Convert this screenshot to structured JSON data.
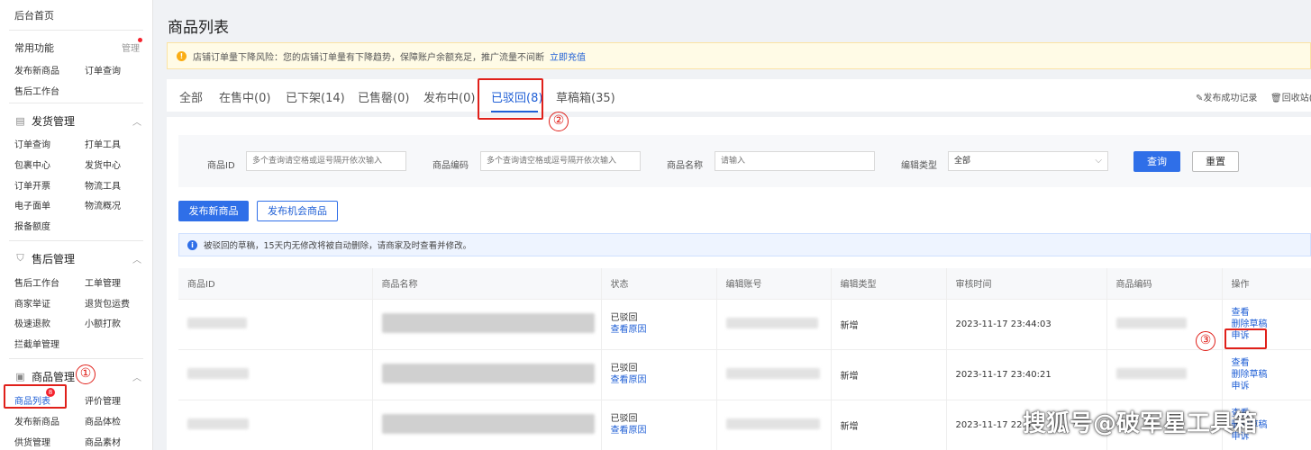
{
  "sidebar": {
    "home": "后台首页",
    "common_title": "常用功能",
    "common_manage": "管理",
    "common_items": [
      "发布新商品",
      "订单查询",
      "售后工作台"
    ],
    "sections": [
      {
        "title": "发货管理",
        "items": [
          "订单查询",
          "打单工具",
          "包裹中心",
          "发货中心",
          "订单开票",
          "物流工具",
          "电子面单",
          "物流概况",
          "报备额度"
        ]
      },
      {
        "title": "售后管理",
        "items": [
          "售后工作台",
          "工单管理",
          "商家举证",
          "退货包运费",
          "极速退款",
          "小额打款",
          "拦截单管理"
        ]
      },
      {
        "title": "商品管理",
        "items": [
          "商品列表",
          "评价管理",
          "发布新商品",
          "商品体检",
          "供货管理",
          "商品素材"
        ]
      }
    ],
    "badge_count": "8"
  },
  "annotations": [
    "①",
    "②",
    "③"
  ],
  "page": {
    "title": "商品列表",
    "warning": "店铺订单量下降风险：您的店铺订单量有下降趋势，保障账户余额充足，推广流量不间断",
    "warning_link": "立即充值"
  },
  "tabs": [
    {
      "label": "全部"
    },
    {
      "label": "在售中(0)"
    },
    {
      "label": "已下架(14)"
    },
    {
      "label": "已售罄(0)"
    },
    {
      "label": "发布中(0)"
    },
    {
      "label": "已驳回(8)"
    },
    {
      "label": "草稿箱(35)"
    }
  ],
  "tab_links": {
    "publish_record": "发布成功记录",
    "recycle": "回收站("
  },
  "filters": {
    "id_label": "商品ID",
    "id_placeholder": "多个查询请空格或逗号隔开依次输入",
    "code_label": "商品编码",
    "code_placeholder": "多个查询请空格或逗号隔开依次输入",
    "name_label": "商品名称",
    "name_placeholder": "请输入",
    "type_label": "编辑类型",
    "type_value": "全部",
    "query": "查询",
    "reset": "重置"
  },
  "actions": {
    "publish_new": "发布新商品",
    "publish_opportunity": "发布机会商品"
  },
  "info": "被驳回的草稿，15天内无修改将被自动删除，请商家及时查看并修改。",
  "table": {
    "headers": [
      "商品ID",
      "商品名称",
      "状态",
      "编辑账号",
      "编辑类型",
      "审核时间",
      "商品编码",
      "操作"
    ],
    "rows": [
      {
        "status": "已驳回",
        "reason": "查看原因",
        "type": "新增",
        "time": "2023-11-17 23:44:03",
        "ops": [
          "查看",
          "删除草稿",
          "申诉"
        ]
      },
      {
        "status": "已驳回",
        "reason": "查看原因",
        "type": "新增",
        "time": "2023-11-17 23:40:21",
        "ops": [
          "查看",
          "删除草稿",
          "申诉"
        ]
      },
      {
        "status": "已驳回",
        "reason": "查看原因",
        "type": "新增",
        "time": "2023-11-17 22:3",
        "ops": [
          "查看",
          "删除草稿",
          "申诉"
        ]
      }
    ]
  },
  "watermark": "搜狐号@破军星工具箱"
}
